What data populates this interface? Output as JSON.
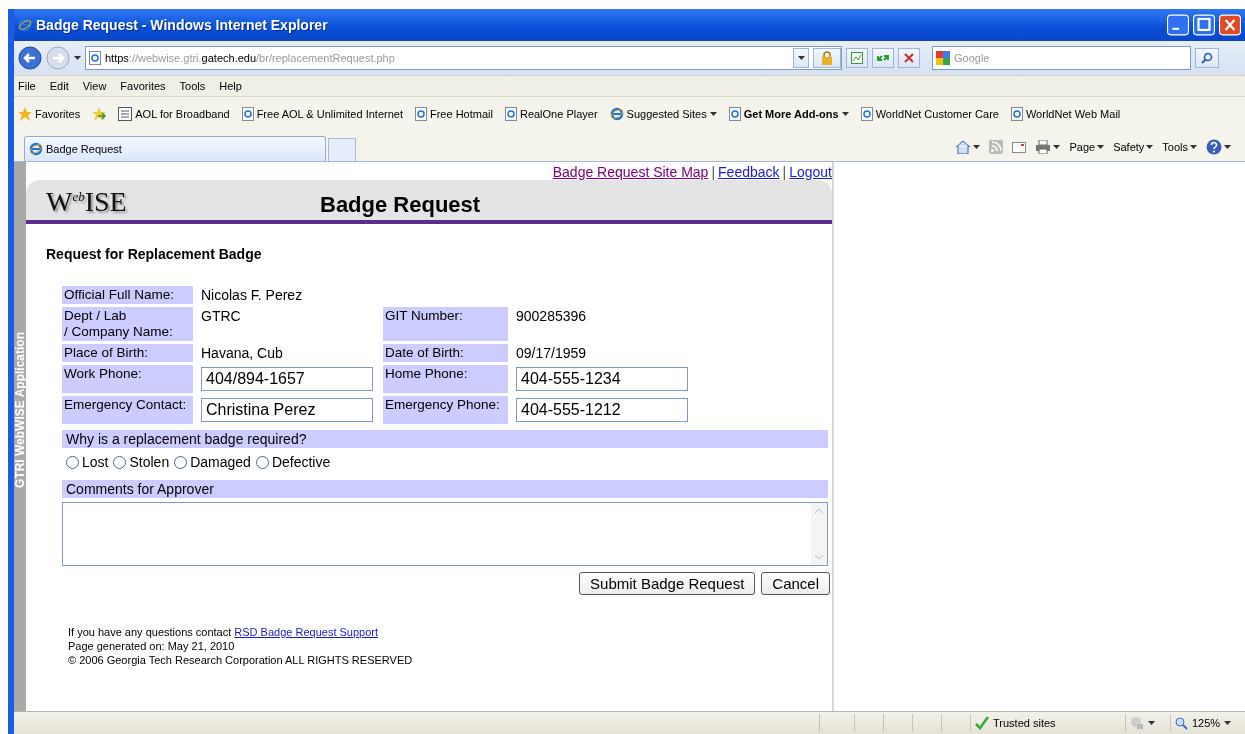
{
  "window": {
    "title": "Badge Request - Windows Internet Explorer"
  },
  "address": {
    "url": [
      {
        "text": "https",
        "dim": false
      },
      {
        "text": "://webwise.gtri.",
        "dim": true
      },
      {
        "text": "gatech.edu",
        "dim": false
      },
      {
        "text": "/br/replacementRequest.php",
        "dim": true
      }
    ],
    "search_placeholder": "Google"
  },
  "menu": [
    "File",
    "Edit",
    "View",
    "Favorites",
    "Tools",
    "Help"
  ],
  "favorites": {
    "label": "Favorites",
    "links": [
      {
        "label": "AOL for Broadband",
        "kind": "aol",
        "bold": false,
        "dropdown": false
      },
      {
        "label": "Free AOL & Unlimited Internet",
        "kind": "ie",
        "bold": false,
        "dropdown": false
      },
      {
        "label": "Free Hotmail",
        "kind": "ie",
        "bold": false,
        "dropdown": false
      },
      {
        "label": "RealOne Player",
        "kind": "ie",
        "bold": false,
        "dropdown": false
      },
      {
        "label": "Suggested Sites",
        "kind": "suggested",
        "bold": false,
        "dropdown": true
      },
      {
        "label": "Get More Add-ons",
        "kind": "ie",
        "bold": true,
        "dropdown": true
      },
      {
        "label": "WorldNet Customer Care",
        "kind": "ie",
        "bold": false,
        "dropdown": false
      },
      {
        "label": "WorldNet Web Mail",
        "kind": "ie",
        "bold": false,
        "dropdown": false
      }
    ]
  },
  "tab": {
    "title": "Badge Request"
  },
  "command_bar": [
    "Page",
    "Safety",
    "Tools"
  ],
  "side_label": "GTRI WebWISE Application",
  "page": {
    "top_links": [
      {
        "label": "Badge Request Site Map",
        "visited": true
      },
      {
        "label": "Feedback",
        "visited": false
      },
      {
        "label": "Logout",
        "visited": false
      }
    ],
    "link_separator": "|",
    "logo": "W$^{eb}$ISE",
    "heading": "Badge Request",
    "form_title": "Request for Replacement Badge",
    "rows": [
      [
        {
          "label": "Official Full Name:",
          "value": "Nicolas F. Perez",
          "kind": "text"
        }
      ],
      [
        {
          "label": "Dept / Lab\n/ Company Name:",
          "value": "GTRC",
          "kind": "text"
        },
        {
          "label": "GIT Number:",
          "value": "900285396",
          "kind": "text"
        }
      ],
      [
        {
          "label": "Place of Birth:",
          "value": "Havana, Cub",
          "kind": "text"
        },
        {
          "label": "Date of Birth:",
          "value": "09/17/1959",
          "kind": "text"
        }
      ],
      [
        {
          "label": "Work Phone:",
          "value": "404/894-1657",
          "kind": "input"
        },
        {
          "label": "Home Phone:",
          "value": "404-555-1234",
          "kind": "input"
        }
      ],
      [
        {
          "label": "Emergency Contact:",
          "value": "Christina Perez",
          "kind": "input"
        },
        {
          "label": "Emergency Phone:",
          "value": "404-555-1212",
          "kind": "input"
        }
      ]
    ],
    "reason_label": "Why is a replacement badge required?",
    "reasons": [
      {
        "label": "Lost",
        "selected": false
      },
      {
        "label": "Stolen",
        "selected": false
      },
      {
        "label": "Damaged",
        "selected": false
      },
      {
        "label": "Defective",
        "selected": false
      }
    ],
    "comments_label": "Comments for Approver",
    "buttons": [
      "Submit Badge Request",
      "Cancel"
    ],
    "footer": [
      {
        "text": "If you have any questions contact ",
        "link": "RSD Badge Request Support"
      },
      {
        "text": "Page generated on: May 21, 2010"
      },
      {
        "text": "© 2006 Georgia Tech Research Corporation ALL RIGHTS RESERVED"
      }
    ]
  },
  "status_bar": {
    "zone": "Trusted sites",
    "zoom": "125%"
  }
}
